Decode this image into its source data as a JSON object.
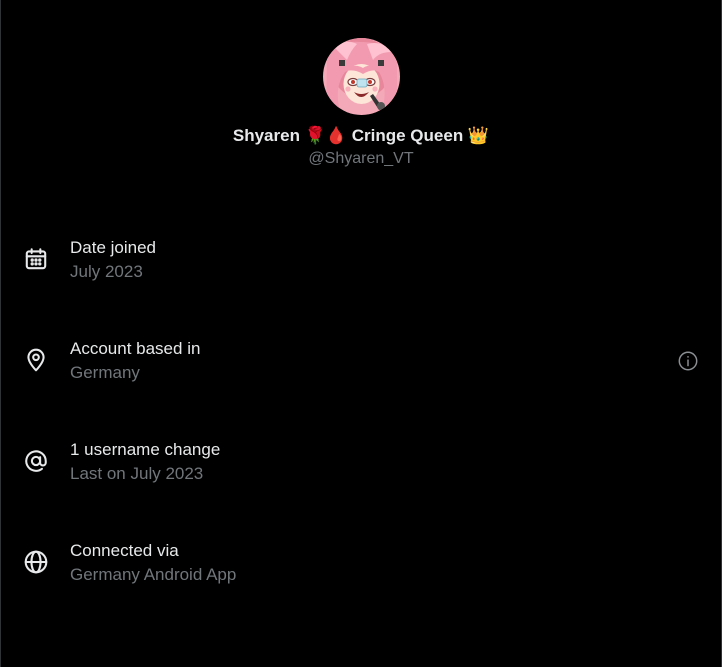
{
  "profile": {
    "display_name": "Shyaren 🌹🩸 Cringe Queen 👑",
    "handle": "@Shyaren_VT",
    "avatar_icon": "avatar-illustration"
  },
  "about": [
    {
      "icon": "calendar-icon",
      "title": "Date joined",
      "subtitle": "July 2023"
    },
    {
      "icon": "location-pin-icon",
      "title": "Account based in",
      "subtitle": "Germany",
      "trailing_icon": "info-icon"
    },
    {
      "icon": "at-sign-icon",
      "title": "1 username change",
      "subtitle": "Last on July 2023"
    },
    {
      "icon": "globe-icon",
      "title": "Connected via",
      "subtitle": "Germany Android App"
    }
  ],
  "colors": {
    "background": "#000000",
    "primary_text": "#e7e9ea",
    "secondary_text": "#71767b",
    "border": "#2f3336"
  }
}
